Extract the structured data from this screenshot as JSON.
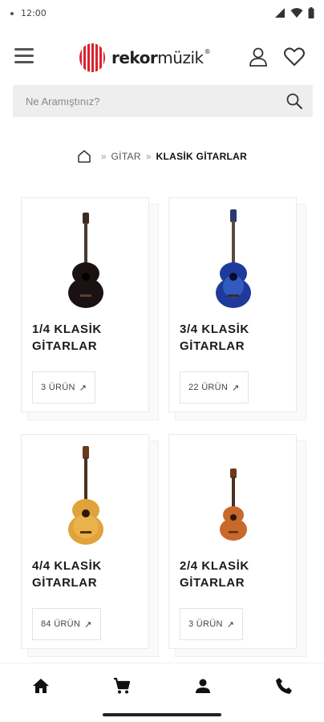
{
  "status_bar": {
    "time": "12:00"
  },
  "header": {
    "logo": {
      "brand_bold": "rekor",
      "brand_light": "müzik",
      "registered": "®"
    },
    "icons": {
      "menu": "hamburger-menu-icon",
      "user": "user-icon",
      "favorites": "heart-icon"
    }
  },
  "search": {
    "placeholder": "Ne Aramıştınız?",
    "value": ""
  },
  "breadcrumb": {
    "home_icon": "home-icon",
    "separator": "»",
    "items": [
      "GİTAR",
      "KLASİK GİTARLAR"
    ]
  },
  "categories": [
    {
      "title_line1": "1/4 KLASİK",
      "title_line2": "GİTARLAR",
      "count": "3 ÜRÜN",
      "arrow": "↗",
      "guitar_color": "#1a1212"
    },
    {
      "title_line1": "3/4 KLASİK",
      "title_line2": "GİTARLAR",
      "count": "22 ÜRÜN",
      "arrow": "↗",
      "guitar_color": "#1e3a9a"
    },
    {
      "title_line1": "4/4 KLASİK",
      "title_line2": "GİTARLAR",
      "count": "84 ÜRÜN",
      "arrow": "↗",
      "guitar_color": "#e0a23a"
    },
    {
      "title_line1": "2/4 KLASİK",
      "title_line2": "GİTARLAR",
      "count": "3 ÜRÜN",
      "arrow": "↗",
      "guitar_color": "#c8682a"
    }
  ],
  "bottom_nav": [
    "home-icon",
    "cart-icon",
    "account-icon",
    "phone-icon"
  ],
  "colors": {
    "brand_red": "#d9232e",
    "search_bg": "#eeeeee",
    "text_dark": "#1a1a1a"
  }
}
